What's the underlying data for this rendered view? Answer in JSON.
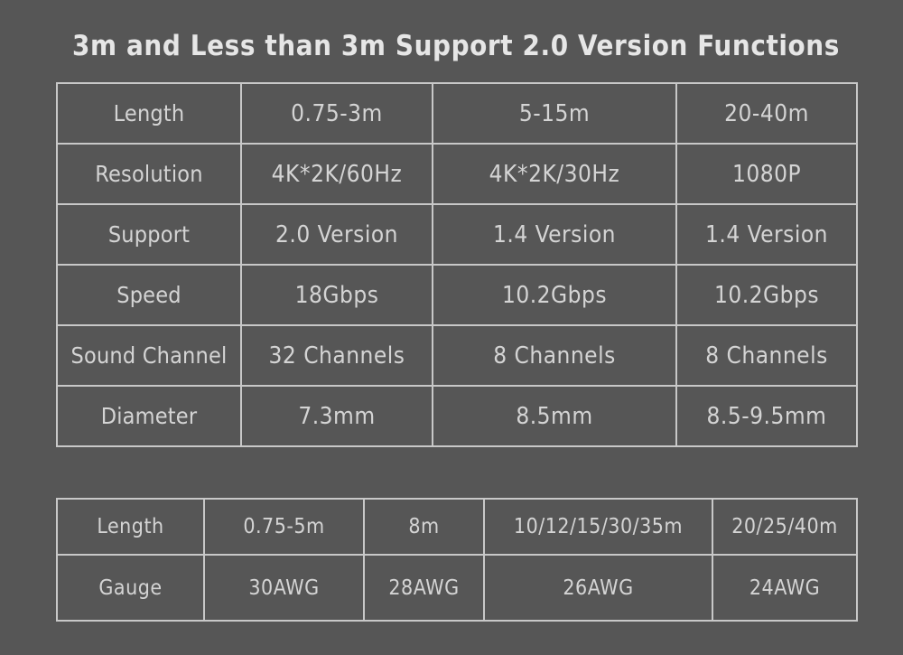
{
  "background_color": "#565656",
  "text_color": "#d4d4d4",
  "border_color": "#c8c8c8",
  "title": "3m and Less than 3m Support 2.0 Version Functions",
  "table_one": {
    "rows": [
      {
        "label": "Length",
        "col1": "0.75-3m",
        "col2": "5-15m",
        "col3": "20-40m"
      },
      {
        "label": "Resolution",
        "col1": "4K*2K/60Hz",
        "col2": "4K*2K/30Hz",
        "col3": "1080P"
      },
      {
        "label": "Support",
        "col1": "2.0 Version",
        "col2": "1.4 Version",
        "col3": "1.4 Version"
      },
      {
        "label": "Speed",
        "col1": "18Gbps",
        "col2": "10.2Gbps",
        "col3": "10.2Gbps"
      },
      {
        "label": "Sound Channel",
        "col1": "32 Channels",
        "col2": "8 Channels",
        "col3": "8 Channels"
      },
      {
        "label": "Diameter",
        "col1": "7.3mm",
        "col2": "8.5mm",
        "col3": "8.5-9.5mm"
      }
    ]
  },
  "table_two": {
    "rows": [
      {
        "label": "Length",
        "col1": "0.75-5m",
        "col2": "8m",
        "col3": "10/12/15/30/35m",
        "col4": "20/25/40m"
      },
      {
        "label": "Gauge",
        "col1": "30AWG",
        "col2": "28AWG",
        "col3": "26AWG",
        "col4": "24AWG"
      }
    ]
  }
}
